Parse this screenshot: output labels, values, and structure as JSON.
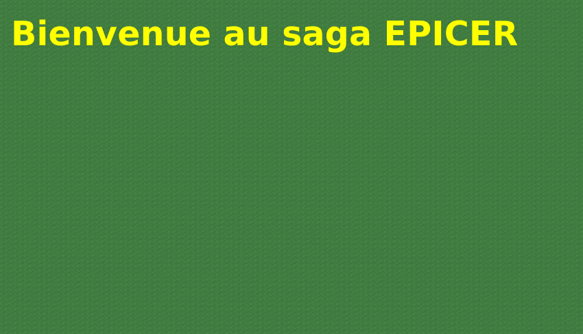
{
  "screen": {
    "title": "Bienvenue au saga EPICER",
    "background_color": "#3f7c3f",
    "title_color": "#ffff00"
  }
}
